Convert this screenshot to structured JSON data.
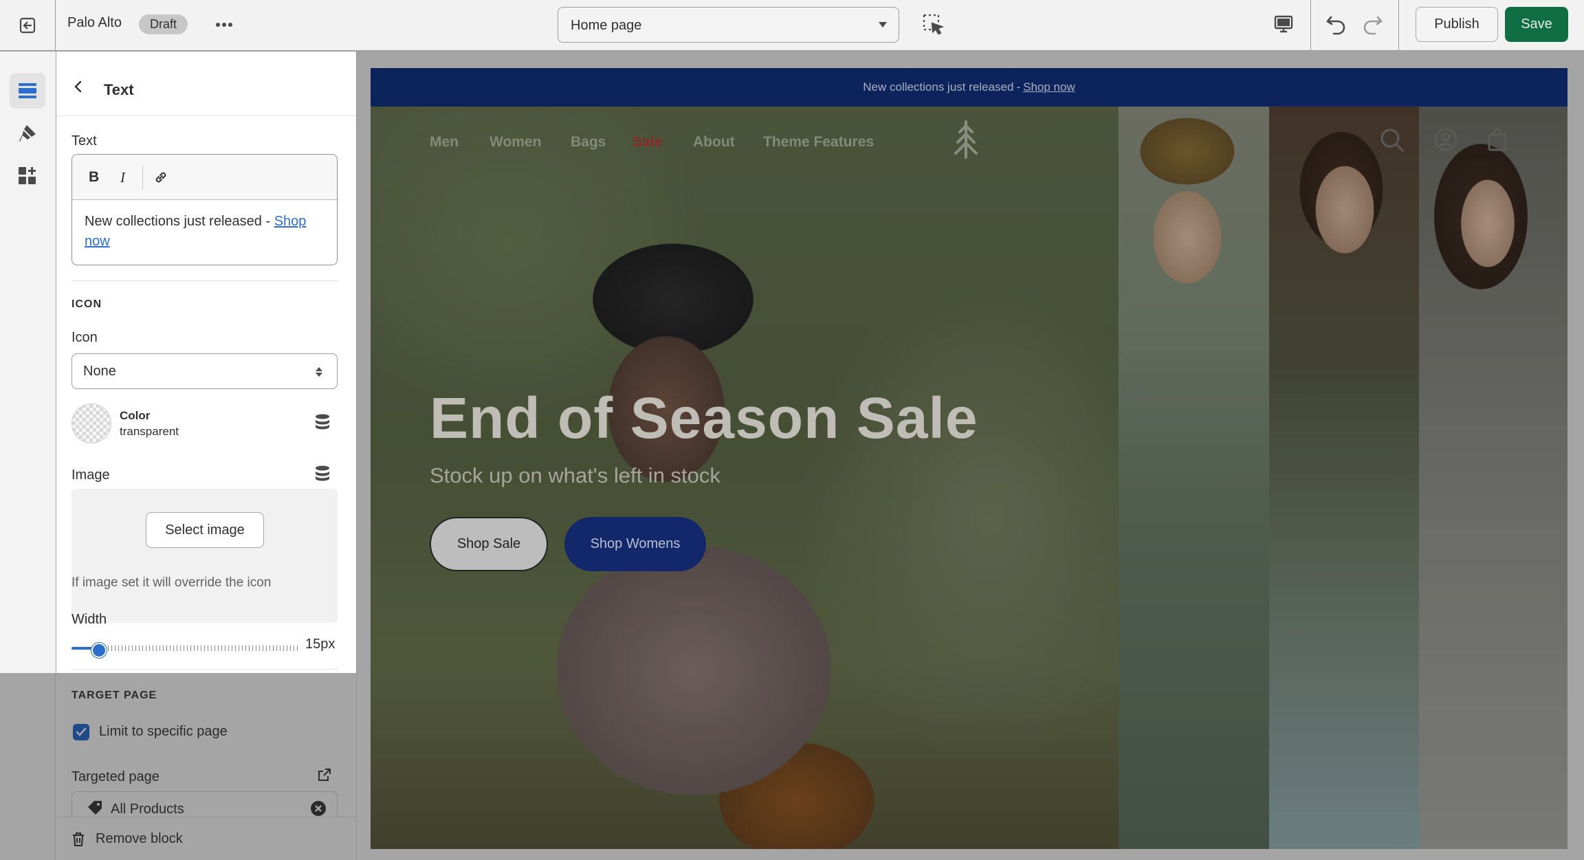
{
  "topbar": {
    "store_name": "Palo Alto",
    "status_badge": "Draft",
    "template_select": "Home page",
    "publish_label": "Publish",
    "save_label": "Save"
  },
  "panel": {
    "title": "Text",
    "text_label": "Text",
    "editor": {
      "content_prefix": "New collections just released - ",
      "link_text": "Shop now"
    },
    "icon_section": "ICON",
    "icon_label": "Icon",
    "icon_value": "None",
    "color_label": "Color",
    "color_value": "transparent",
    "image_label": "Image",
    "select_image_button": "Select image",
    "image_help": "If image set it will override the icon",
    "width_label": "Width",
    "width_value": "15px",
    "width_fraction": 0.12,
    "target_section": "TARGET PAGE",
    "limit_checkbox_label": "Limit to specific page",
    "limit_checked": true,
    "targeted_page_label": "Targeted page",
    "targeted_page_value": "All Products",
    "remove_block": "Remove block"
  },
  "preview": {
    "announcement": {
      "text": "New collections just released",
      "separator": "-",
      "link": "Shop now"
    },
    "nav": [
      "Men",
      "Women",
      "Bags",
      "Sale",
      "About",
      "Theme Features"
    ],
    "hero": {
      "title": "End of Season Sale",
      "subtitle": "Stock up on what's left in stock",
      "primary_button": "Shop Sale",
      "secondary_button": "Shop Womens"
    }
  },
  "colors": {
    "save_green": "#0f6e43",
    "announcement_bg": "#0d235c",
    "accent_blue": "#2c6ecb",
    "sale_red": "#8a2d2a"
  },
  "icons": {
    "exit": "exit-icon",
    "more": "more-horizontal-icon",
    "inspect": "inspect-icon",
    "desktop": "desktop-icon",
    "undo": "undo-icon",
    "redo": "redo-icon",
    "sections": "sections-icon",
    "theme_settings": "paintbrush-icon",
    "apps": "apps-icon"
  }
}
